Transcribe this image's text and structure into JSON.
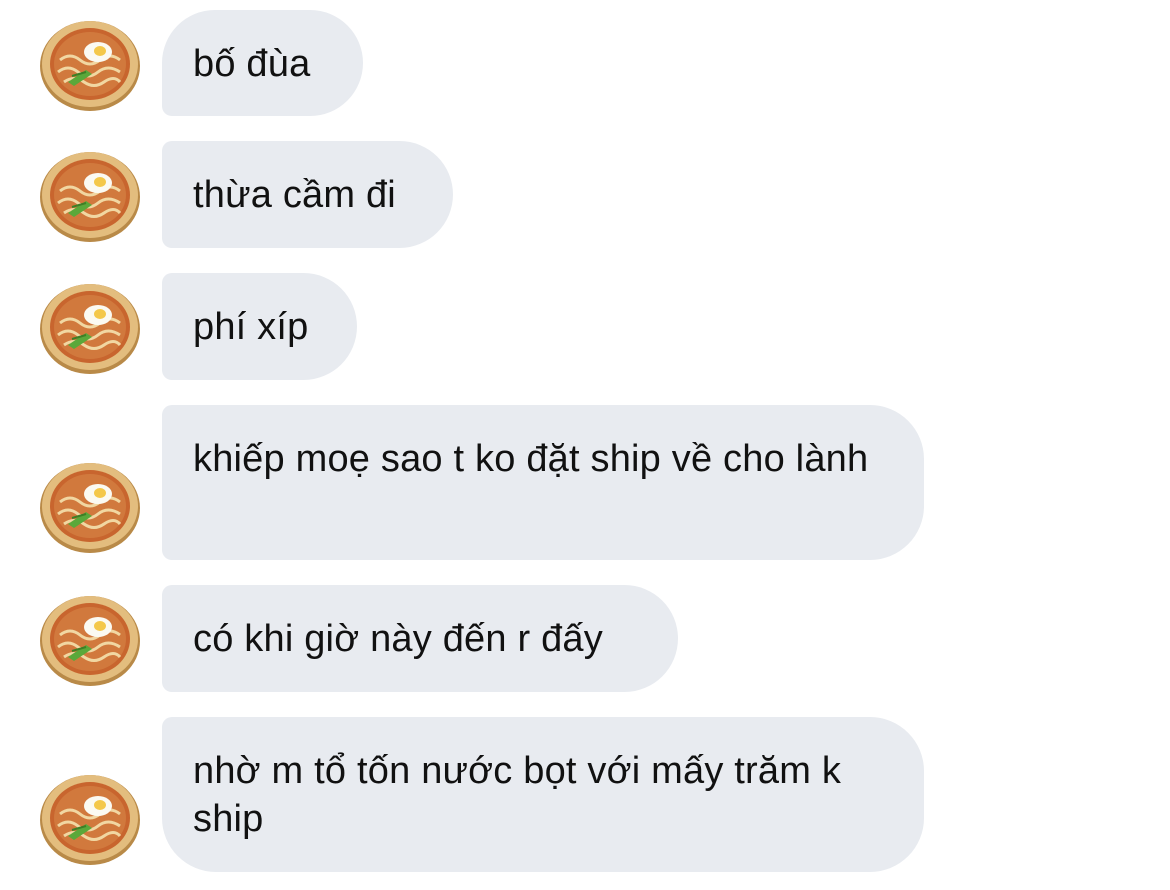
{
  "messages": [
    {
      "text": "bố đùa",
      "avatar_icon": "ramen-bowl-icon"
    },
    {
      "text": "thừa cầm đi",
      "avatar_icon": "ramen-bowl-icon"
    },
    {
      "text": "phí xíp",
      "avatar_icon": "ramen-bowl-icon"
    },
    {
      "text": "khiếp moẹ sao t ko đặt ship về cho lành",
      "avatar_icon": "ramen-bowl-icon"
    },
    {
      "text": "có khi giờ này đến r đấy",
      "avatar_icon": "ramen-bowl-icon"
    },
    {
      "text": "nhờ m tổ tốn nước bọt với mấy trăm k ship",
      "avatar_icon": "ramen-bowl-icon"
    }
  ],
  "colors": {
    "bubble_background": "#e8ebf0",
    "text": "#111111",
    "page_background": "#ffffff",
    "bowl_rim": "#d8ad6b",
    "broth": "#c8652e",
    "egg_yolk": "#f4c84a",
    "scallion": "#5aa83a"
  }
}
